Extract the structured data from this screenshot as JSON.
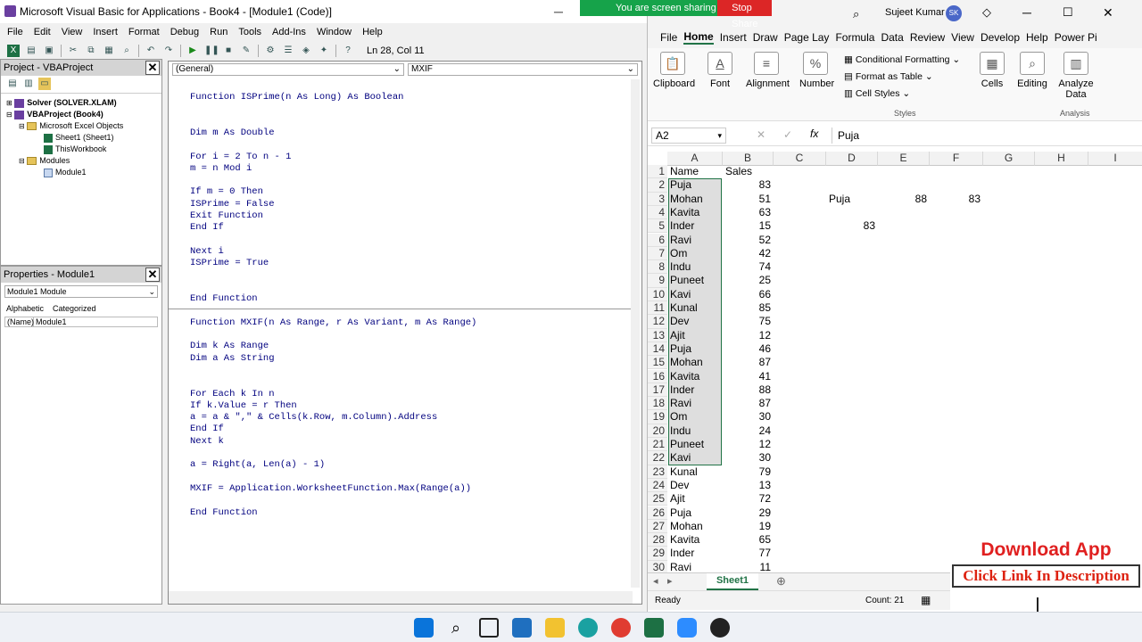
{
  "vbe": {
    "title": "Microsoft Visual Basic for Applications - Book4 - [Module1 (Code)]",
    "menu": [
      "File",
      "Edit",
      "View",
      "Insert",
      "Format",
      "Debug",
      "Run",
      "Tools",
      "Add-Ins",
      "Window",
      "Help"
    ],
    "position": "Ln 28, Col 11",
    "project_title": "Project - VBAProject",
    "tree": [
      "Solver (SOLVER.XLAM)",
      "VBAProject (Book4)",
      "Microsoft Excel Objects",
      "Sheet1 (Sheet1)",
      "ThisWorkbook",
      "Modules",
      "Module1"
    ],
    "properties_title": "Properties - Module1",
    "prop_combo": "Module1 Module",
    "prop_tabs": [
      "Alphabetic",
      "Categorized"
    ],
    "prop_name_key": "(Name)",
    "prop_name_val": "Module1",
    "combo_left": "(General)",
    "combo_right": "MXIF",
    "code": [
      "Function ISPrime(n As Long) As Boolean",
      "",
      "",
      "Dim m As Double",
      "",
      "For i = 2 To n - 1",
      "m = n Mod i",
      "",
      "If m = 0 Then",
      "ISPrime = False",
      "Exit Function",
      "End If",
      "",
      "Next i",
      "ISPrime = True",
      "",
      "",
      "End Function",
      "---",
      "Function MXIF(n As Range, r As Variant, m As Range)",
      "",
      "Dim k As Range",
      "Dim a As String",
      "",
      "",
      "For Each k In n",
      "If k.Value = r Then",
      "a = a & \",\" & Cells(k.Row, m.Column).Address",
      "End If",
      "Next k",
      "",
      "a = Right(a, Len(a) - 1)",
      "",
      "MXIF = Application.WorksheetFunction.Max(Range(a))",
      "",
      "End Function"
    ]
  },
  "share": {
    "sharing": "You are screen sharing",
    "stop": "Stop Share",
    "user": "Sujeet Kumar",
    "initials": "SK"
  },
  "excel": {
    "tabs": [
      "File",
      "Home",
      "Insert",
      "Draw",
      "Page Lay",
      "Formula",
      "Data",
      "Review",
      "View",
      "Develop",
      "Help",
      "Power Pi"
    ],
    "active_tab": "Home",
    "groups": [
      "Clipboard",
      "Font",
      "Alignment",
      "Number",
      "Cells",
      "Editing",
      "Analyze Data"
    ],
    "styles": [
      "Conditional Formatting",
      "Format as Table",
      "Cell Styles"
    ],
    "styles_label": "Styles",
    "analysis_label": "Analysis",
    "namebox": "A2",
    "formula": "Puja",
    "columns": [
      "A",
      "B",
      "C",
      "D",
      "E",
      "F",
      "G",
      "H",
      "I"
    ],
    "header_row": [
      "Name",
      "Sales"
    ],
    "rows": [
      [
        "Puja",
        83
      ],
      [
        "Mohan",
        51
      ],
      [
        "Kavita",
        63
      ],
      [
        "Inder",
        15
      ],
      [
        "Ravi",
        52
      ],
      [
        "Om",
        42
      ],
      [
        "Indu",
        74
      ],
      [
        "Puneet",
        25
      ],
      [
        "Kavi",
        66
      ],
      [
        "Kunal",
        85
      ],
      [
        "Dev",
        75
      ],
      [
        "Ajit",
        12
      ],
      [
        "Puja",
        46
      ],
      [
        "Mohan",
        87
      ],
      [
        "Kavita",
        41
      ],
      [
        "Inder",
        88
      ],
      [
        "Ravi",
        87
      ],
      [
        "Om",
        30
      ],
      [
        "Indu",
        24
      ],
      [
        "Puneet",
        12
      ],
      [
        "Kavi",
        30
      ],
      [
        "Kunal",
        79
      ],
      [
        "Dev",
        13
      ],
      [
        "Ajit",
        72
      ],
      [
        "Puja",
        29
      ],
      [
        "Mohan",
        19
      ],
      [
        "Kavita",
        65
      ],
      [
        "Inder",
        77
      ],
      [
        "Ravi",
        11
      ]
    ],
    "d3": "Puja",
    "e3": "88",
    "f3": "83",
    "d5": "83",
    "sheet": "Sheet1",
    "status_ready": "Ready",
    "status_count": "Count: 21"
  },
  "promo": {
    "download": "Download App",
    "link": "Click Link In Description"
  }
}
